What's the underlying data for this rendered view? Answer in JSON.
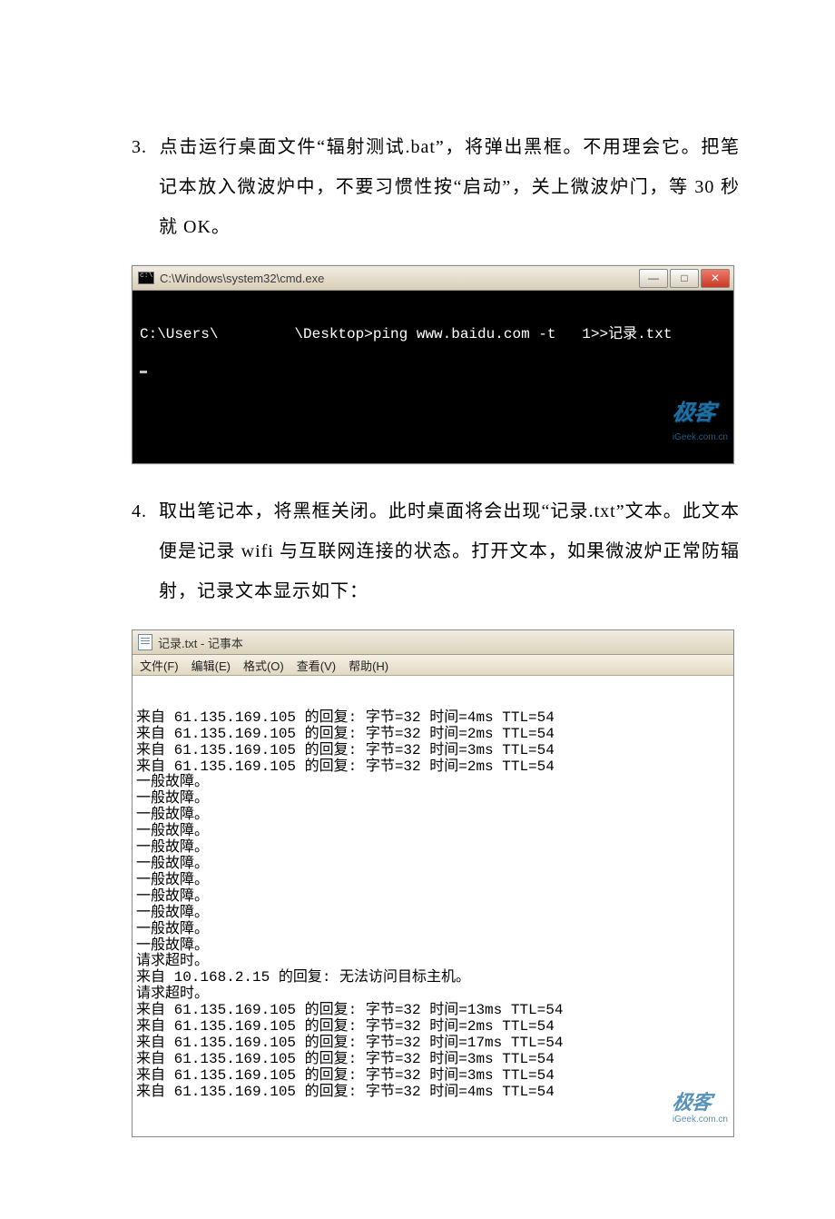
{
  "step3": {
    "num": "3.",
    "text": "点击运行桌面文件“辐射测试.bat”，将弹出黑框。不用理会它。把笔记本放入微波炉中，不要习惯性按“启动”，关上微波炉门，等 30 秒就 OK。"
  },
  "step4": {
    "num": "4.",
    "text": "取出笔记本，将黑框关闭。此时桌面将会出现“记录.txt”文本。此文本便是记录 wifi 与互联网连接的状态。打开文本，如果微波炉正常防辐射，记录文本显示如下："
  },
  "cmd": {
    "title": "C:\\Windows\\system32\\cmd.exe",
    "line_prefix": "C:\\Users\\",
    "line_suffix": "\\Desktop>ping www.baidu.com -t   1>>记录.txt",
    "watermark_big": "极客",
    "watermark_small": "iGeek.com.cn"
  },
  "notepad": {
    "title": "记录.txt - 记事本",
    "menu": {
      "file": "文件(F)",
      "edit": "编辑(E)",
      "format": "格式(O)",
      "view": "查看(V)",
      "help": "帮助(H)"
    },
    "lines": [
      "来自 61.135.169.105 的回复: 字节=32 时间=4ms TTL=54",
      "来自 61.135.169.105 的回复: 字节=32 时间=2ms TTL=54",
      "来自 61.135.169.105 的回复: 字节=32 时间=3ms TTL=54",
      "来自 61.135.169.105 的回复: 字节=32 时间=2ms TTL=54",
      "一般故障。",
      "一般故障。",
      "一般故障。",
      "一般故障。",
      "一般故障。",
      "一般故障。",
      "一般故障。",
      "一般故障。",
      "一般故障。",
      "一般故障。",
      "一般故障。",
      "请求超时。",
      "来自 10.168.2.15 的回复: 无法访问目标主机。",
      "请求超时。",
      "来自 61.135.169.105 的回复: 字节=32 时间=13ms TTL=54",
      "来自 61.135.169.105 的回复: 字节=32 时间=2ms TTL=54",
      "来自 61.135.169.105 的回复: 字节=32 时间=17ms TTL=54",
      "来自 61.135.169.105 的回复: 字节=32 时间=3ms TTL=54",
      "来自 61.135.169.105 的回复: 字节=32 时间=3ms TTL=54",
      "来自 61.135.169.105 的回复: 字节=32 时间=4ms TTL=54"
    ],
    "watermark_big": "极客",
    "watermark_small": "iGeek.com.cn"
  }
}
